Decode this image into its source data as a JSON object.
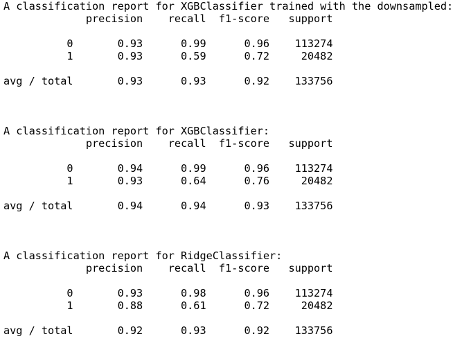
{
  "output": {
    "lines": [
      "A classification report for XGBClassifier trained with the downsampled:",
      "             precision    recall  f1-score   support",
      "",
      "          0       0.93      0.99      0.96    113274",
      "          1       0.93      0.59      0.72     20482",
      "",
      "avg / total       0.93      0.93      0.92    133756",
      "",
      "",
      "",
      "A classification report for XGBClassifier:",
      "             precision    recall  f1-score   support",
      "",
      "          0       0.94      0.99      0.96    113274",
      "          1       0.93      0.64      0.76     20482",
      "",
      "avg / total       0.94      0.94      0.93    133756",
      "",
      "",
      "",
      "A classification report for RidgeClassifier:",
      "             precision    recall  f1-score   support",
      "",
      "          0       0.93      0.98      0.96    113274",
      "          1       0.88      0.61      0.72     20482",
      "",
      "avg / total       0.92      0.93      0.92    133756"
    ]
  }
}
